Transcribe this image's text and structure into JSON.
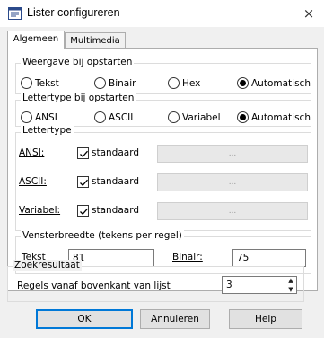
{
  "window": {
    "title": "Lister configureren",
    "close_glyph": "×"
  },
  "tabs": [
    {
      "label": "Algemeen",
      "active": true
    },
    {
      "label": "Multimedia",
      "active": false
    }
  ],
  "display_group": {
    "label": "Weergave bij opstarten",
    "options": [
      {
        "label": "Tekst",
        "checked": false
      },
      {
        "label": "Binair",
        "checked": false
      },
      {
        "label": "Hex",
        "checked": false
      },
      {
        "label": "Automatisch",
        "checked": true
      }
    ]
  },
  "font_startup_group": {
    "label": "Lettertype bij opstarten",
    "options": [
      {
        "label": "ANSI",
        "checked": false
      },
      {
        "label": "ASCII",
        "checked": false
      },
      {
        "label": "Variabel",
        "checked": false
      },
      {
        "label": "Automatisch",
        "checked": true
      }
    ]
  },
  "font_group": {
    "label": "Lettertype",
    "rows": [
      {
        "label": "ANSI:",
        "checkbox_label": "standaard",
        "checked": true,
        "button": "..."
      },
      {
        "label": "ASCII:",
        "checkbox_label": "standaard",
        "checked": true,
        "button": "..."
      },
      {
        "label": "Variabel:",
        "checkbox_label": "standaard",
        "checked": true,
        "button": "..."
      }
    ]
  },
  "width_group": {
    "label": "Vensterbreedte (tekens per regel)",
    "text_label": "Tekst",
    "text_value": "81",
    "binary_label": "Binair:",
    "binary_value": "75"
  },
  "search_group": {
    "label": "Zoekresultaat",
    "lines_label": "Regels vanaf bovenkant van lijst",
    "lines_value": "3"
  },
  "buttons": {
    "ok": "OK",
    "cancel": "Annuleren",
    "help": "Help"
  },
  "colors": {
    "accent": "#0078d7",
    "dialog_bg": "#f0f0f0",
    "panel_bg": "#ffffff"
  }
}
